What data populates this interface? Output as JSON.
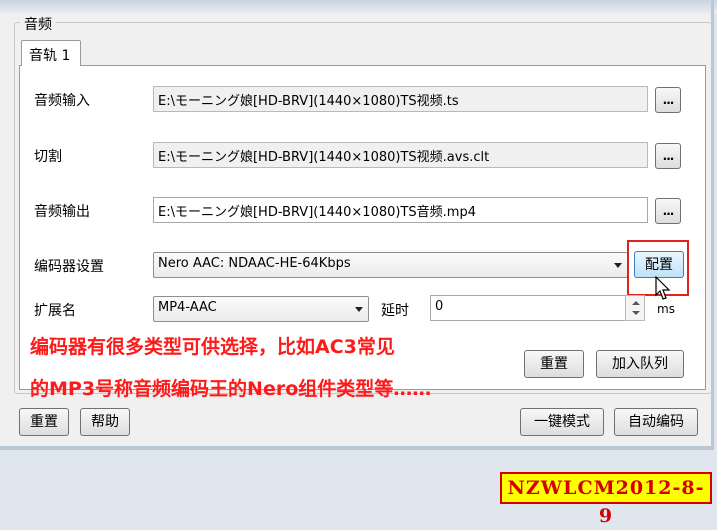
{
  "group_title": "音频",
  "tab_label": "音轨 1",
  "rows": {
    "audio_input": {
      "label": "音频输入",
      "value": "E:\\モーニング娘[HD-BRV](1440×1080)TS视频.ts",
      "browse": "..."
    },
    "cut": {
      "label": "切割",
      "value": "E:\\モーニング娘[HD-BRV](1440×1080)TS视频.avs.clt",
      "browse": "..."
    },
    "audio_output": {
      "label": "音频输出",
      "value": "E:\\モーニング娘[HD-BRV](1440×1080)TS音频.mp4",
      "browse": "..."
    }
  },
  "encoder": {
    "label": "编码器设置",
    "selected": "Nero AAC: NDAAC-HE-64Kbps",
    "config_button": "配置"
  },
  "extension": {
    "label": "扩展名",
    "selected": "MP4-AAC"
  },
  "delay": {
    "label": "延时",
    "value": "0",
    "unit": "ms"
  },
  "panel_buttons": {
    "reset": "重置",
    "add_queue": "加入队列"
  },
  "bottom_buttons": {
    "reset": "重置",
    "help": "帮助",
    "one_key": "一键模式",
    "auto_encode": "自动编码"
  },
  "annotation": {
    "line1": "编码器有很多类型可供选择，比如AC3常见",
    "line2": "的MP3号称音频编码王的Nero组件类型等……"
  },
  "watermark": "NZWLCM2012-8-9",
  "colors": {
    "annotation": "#ff1a1a",
    "highlight_box": "#e0241c",
    "stamp_bg": "#ffff00"
  }
}
